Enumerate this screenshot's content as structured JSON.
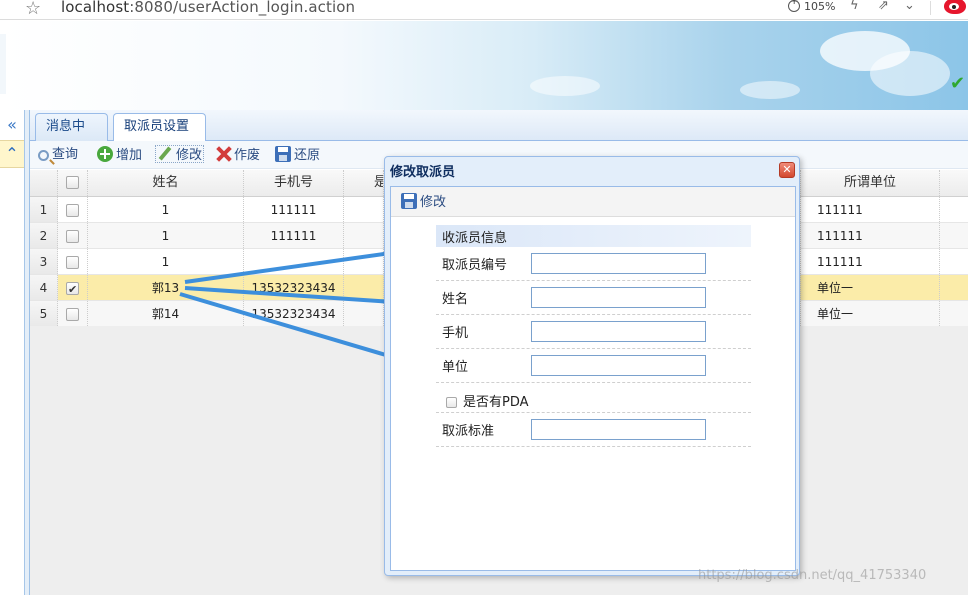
{
  "browser": {
    "url_host": "localhost",
    "url_rest": ":8080/userAction_login.action",
    "zoom": "105%",
    "star_icon": "star-icon",
    "zoom_icon": "zoom-icon",
    "bolt_icon": "lightning-icon",
    "share_icon": "share-icon",
    "chevron_icon": "chevron-down-icon",
    "extension_icon": "weibo-icon"
  },
  "sidebar": {
    "collapse_icon": "double-chevron-left-icon",
    "expand_icon": "double-chevron-up-icon"
  },
  "tabs": [
    {
      "label": "消息中心"
    },
    {
      "label": "取派员设置",
      "close": "×"
    }
  ],
  "toolbar": {
    "query": "查询",
    "add": "增加",
    "edit": "修改",
    "void": "作废",
    "restore": "还原"
  },
  "grid": {
    "columns": [
      "姓名",
      "手机号",
      "是",
      "所谓单位"
    ],
    "rows": [
      {
        "num": "1",
        "name": "1",
        "phone": "111111",
        "unit": "111111",
        "checked": false
      },
      {
        "num": "2",
        "name": "1",
        "phone": "111111",
        "unit": "111111",
        "checked": false
      },
      {
        "num": "3",
        "name": "1",
        "phone": "",
        "unit": "111111",
        "checked": false
      },
      {
        "num": "4",
        "name": "郭13",
        "phone": "13532323434",
        "unit": "单位一",
        "checked": true
      },
      {
        "num": "5",
        "name": "郭14",
        "phone": "13532323434",
        "unit": "单位一",
        "checked": false
      }
    ]
  },
  "dialog": {
    "title": "修改取派员",
    "close": "✕",
    "save_label": "修改",
    "section_title": "收派员信息",
    "fields": {
      "courier_no": {
        "label": "取派员编号",
        "value": ""
      },
      "name": {
        "label": "姓名",
        "value": ""
      },
      "phone": {
        "label": "手机",
        "value": ""
      },
      "unit": {
        "label": "单位",
        "value": ""
      },
      "has_pda": {
        "label": "是否有PDA",
        "checked": false
      },
      "standard": {
        "label": "取派标准",
        "value": ""
      }
    }
  },
  "colors": {
    "accent": "#99bbe8",
    "selected_row": "#fbeca9",
    "arrow": "#3d8fdc"
  },
  "watermark": "https://blog.csdn.net/qq_41753340"
}
